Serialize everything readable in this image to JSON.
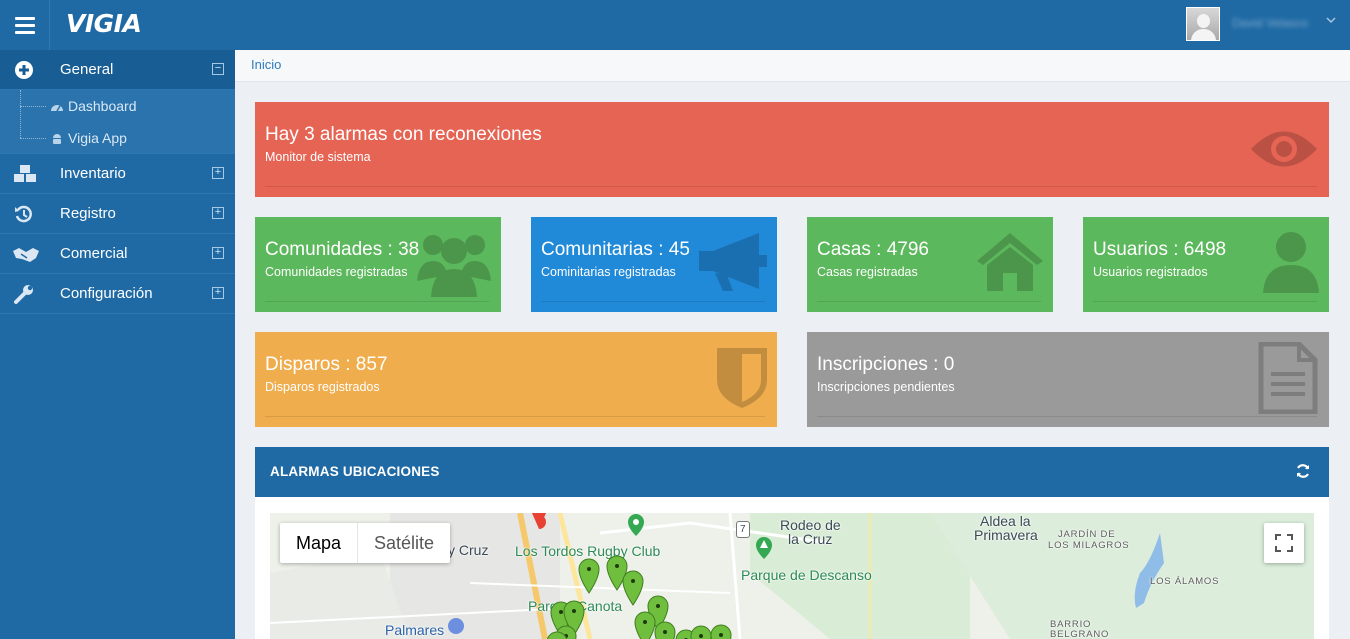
{
  "app": {
    "logo": "VIGIA",
    "user_name": "David Velasco"
  },
  "sidebar": {
    "items": [
      {
        "label": "General",
        "toggle": "⊟"
      },
      {
        "label": "Inventario",
        "toggle": "⊞"
      },
      {
        "label": "Registro",
        "toggle": "⊞"
      },
      {
        "label": "Comercial",
        "toggle": "⊞"
      },
      {
        "label": "Configuración",
        "toggle": "⊞"
      }
    ],
    "sub_items": [
      {
        "label": "Dashboard"
      },
      {
        "label": "Vigia App"
      }
    ]
  },
  "breadcrumb": {
    "home": "Inicio"
  },
  "alert_tile": {
    "title": "Hay 3 alarmas con reconexiones",
    "subtitle": "Monitor de sistema",
    "color": "#e66454"
  },
  "stat_tiles": [
    {
      "title": "Comunidades : 38",
      "subtitle": "Comunidades registradas",
      "color": "#5cb85c",
      "icon": "users-icon"
    },
    {
      "title": "Comunitarias : 45",
      "subtitle": "Cominitarias registradas",
      "color": "#2089d8",
      "icon": "megaphone-icon"
    },
    {
      "title": "Casas : 4796",
      "subtitle": "Casas registradas",
      "color": "#5cb85c",
      "icon": "house-icon"
    },
    {
      "title": "Usuarios : 6498",
      "subtitle": "Usuarios registrados",
      "color": "#5cb85c",
      "icon": "user-icon"
    },
    {
      "title": "Disparos : 857",
      "subtitle": "Disparos registrados",
      "color": "#f0ad4e",
      "icon": "shield-icon"
    },
    {
      "title": "Inscripciones : 0",
      "subtitle": "Inscripciones pendientes",
      "color": "#9a9a9a",
      "icon": "document-icon"
    }
  ],
  "map_panel": {
    "title": "ALARMAS UBICACIONES",
    "tabs": [
      "Mapa",
      "Satélite"
    ],
    "labels": [
      "y Cruz",
      "Los Tordos Rugby Club",
      "Rodeo de",
      "la Cruz",
      "Parque de Descanso",
      "Aldea la",
      "Primavera",
      "JARDÍN DE",
      "LOS MILAGROS",
      "LOS ÁLAMOS",
      "BARRIO",
      "BELGRANO",
      "Parque Canota",
      "Palmares",
      "7"
    ]
  }
}
